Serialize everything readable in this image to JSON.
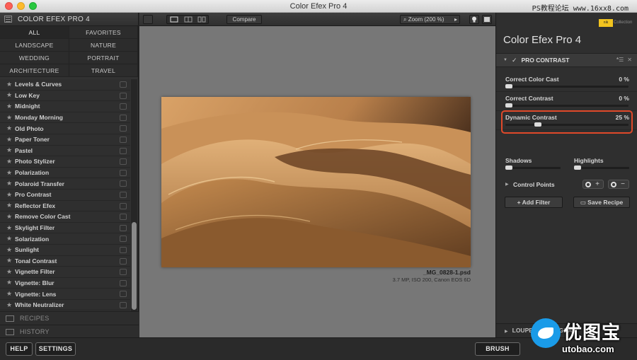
{
  "window": {
    "title": "Color Efex Pro 4",
    "watermark": "PS教程论坛 www.16xx8.com"
  },
  "left_panel": {
    "header": "COLOR EFEX PRO 4",
    "categories": [
      "ALL",
      "FAVORITES",
      "LANDSCAPE",
      "NATURE",
      "WEDDING",
      "PORTRAIT",
      "ARCHITECTURE",
      "TRAVEL"
    ],
    "filters": [
      "Levels & Curves",
      "Low Key",
      "Midnight",
      "Monday Morning",
      "Old Photo",
      "Paper Toner",
      "Pastel",
      "Photo Stylizer",
      "Polarization",
      "Polaroid Transfer",
      "Pro Contrast",
      "Reflector Efex",
      "Remove Color Cast",
      "Skylight Filter",
      "Solarization",
      "Sunlight",
      "Tonal Contrast",
      "Vignette Filter",
      "Vignette: Blur",
      "Vignette: Lens",
      "White Neutralizer"
    ],
    "recipes": "RECIPES",
    "history": "HISTORY"
  },
  "toolbar": {
    "compare": "Compare",
    "zoom": "Zoom (200 %)"
  },
  "image": {
    "filename": "_MG_0828-1.psd",
    "meta": "3.7 MP, ISO 200, Canon EOS 6D"
  },
  "right_panel": {
    "brand_badge": "Collection",
    "title_text": "Color Efex Pro",
    "title_version": "4",
    "filter_name": "PRO CONTRAST",
    "params": [
      {
        "label": "Correct Color Cast",
        "value": "0 %",
        "level": 0
      },
      {
        "label": "Correct Contrast",
        "value": "0 %",
        "level": 0
      },
      {
        "label": "Dynamic Contrast",
        "value": "25 %",
        "level": 0.25
      }
    ],
    "shadows": "Shadows",
    "highlights": "Highlights",
    "control_points": "Control Points",
    "add_filter": "Add Filter",
    "save_recipe": "Save Recipe",
    "loupe": "LOUPE & HISTOGRAM"
  },
  "bottom": {
    "help": "HELP",
    "settings": "SETTINGS",
    "brush": "BRUSH"
  },
  "brand": {
    "name": "优图宝",
    "url": "utobao.com"
  },
  "colors": {
    "highlight_border": "#e0492a",
    "accent_yellow": "#f2c41f"
  }
}
